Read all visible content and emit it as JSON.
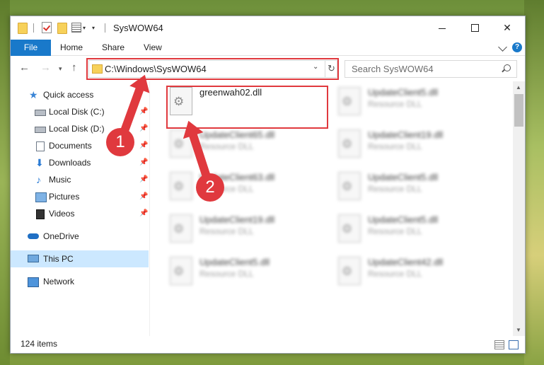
{
  "window": {
    "title": "SysWOW64",
    "controls": {
      "minimize": "",
      "maximize": "",
      "close": "✕"
    }
  },
  "ribbon": {
    "tabs": [
      {
        "label": "File",
        "active": true
      },
      {
        "label": "Home"
      },
      {
        "label": "Share"
      },
      {
        "label": "View"
      }
    ],
    "help": "?"
  },
  "address": {
    "path": "C:\\Windows\\SysWOW64",
    "search_placeholder": "Search SysWOW64"
  },
  "sidebar": {
    "items": [
      {
        "label": "Quick access",
        "icon": "star-icon",
        "pinned": false
      },
      {
        "label": "Local Disk (C:)",
        "icon": "drive-icon",
        "pinned": true
      },
      {
        "label": "Local Disk (D:)",
        "icon": "drive-icon",
        "pinned": true
      },
      {
        "label": "Documents",
        "icon": "documents-icon",
        "pinned": true
      },
      {
        "label": "Downloads",
        "icon": "download-icon",
        "pinned": true
      },
      {
        "label": "Music",
        "icon": "music-icon",
        "pinned": true
      },
      {
        "label": "Pictures",
        "icon": "pictures-icon",
        "pinned": true
      },
      {
        "label": "Videos",
        "icon": "videos-icon",
        "pinned": true
      },
      {
        "label": "OneDrive",
        "icon": "cloud-icon",
        "pinned": false
      },
      {
        "label": "This PC",
        "icon": "computer-icon",
        "pinned": false,
        "selected": true
      },
      {
        "label": "Network",
        "icon": "network-icon",
        "pinned": false
      }
    ]
  },
  "files": {
    "highlighted": {
      "name": "greenwah02.dll",
      "description": ""
    },
    "others": [
      {
        "name": "UpdateClient5.dll",
        "description": "Resource DLL"
      },
      {
        "name": "UpdateClient65.dll",
        "description": "Resource DLL"
      },
      {
        "name": "UpdateClient19.dll",
        "description": "Resource DLL"
      },
      {
        "name": "UpdateClient63.dll",
        "description": "Resource DLL"
      },
      {
        "name": "UpdateClient5.dll",
        "description": "Resource DLL"
      },
      {
        "name": "UpdateClient19.dll",
        "description": "Resource DLL"
      },
      {
        "name": "UpdateClient5.dll",
        "description": "Resource DLL"
      },
      {
        "name": "UpdateClient5.dll",
        "description": "Resource DLL"
      },
      {
        "name": "UpdateClient42.dll",
        "description": "Resource DLL"
      }
    ]
  },
  "status": {
    "item_count": "124 items"
  },
  "annotations": {
    "step1": "1",
    "step2": "2",
    "color": "#e0393e"
  }
}
